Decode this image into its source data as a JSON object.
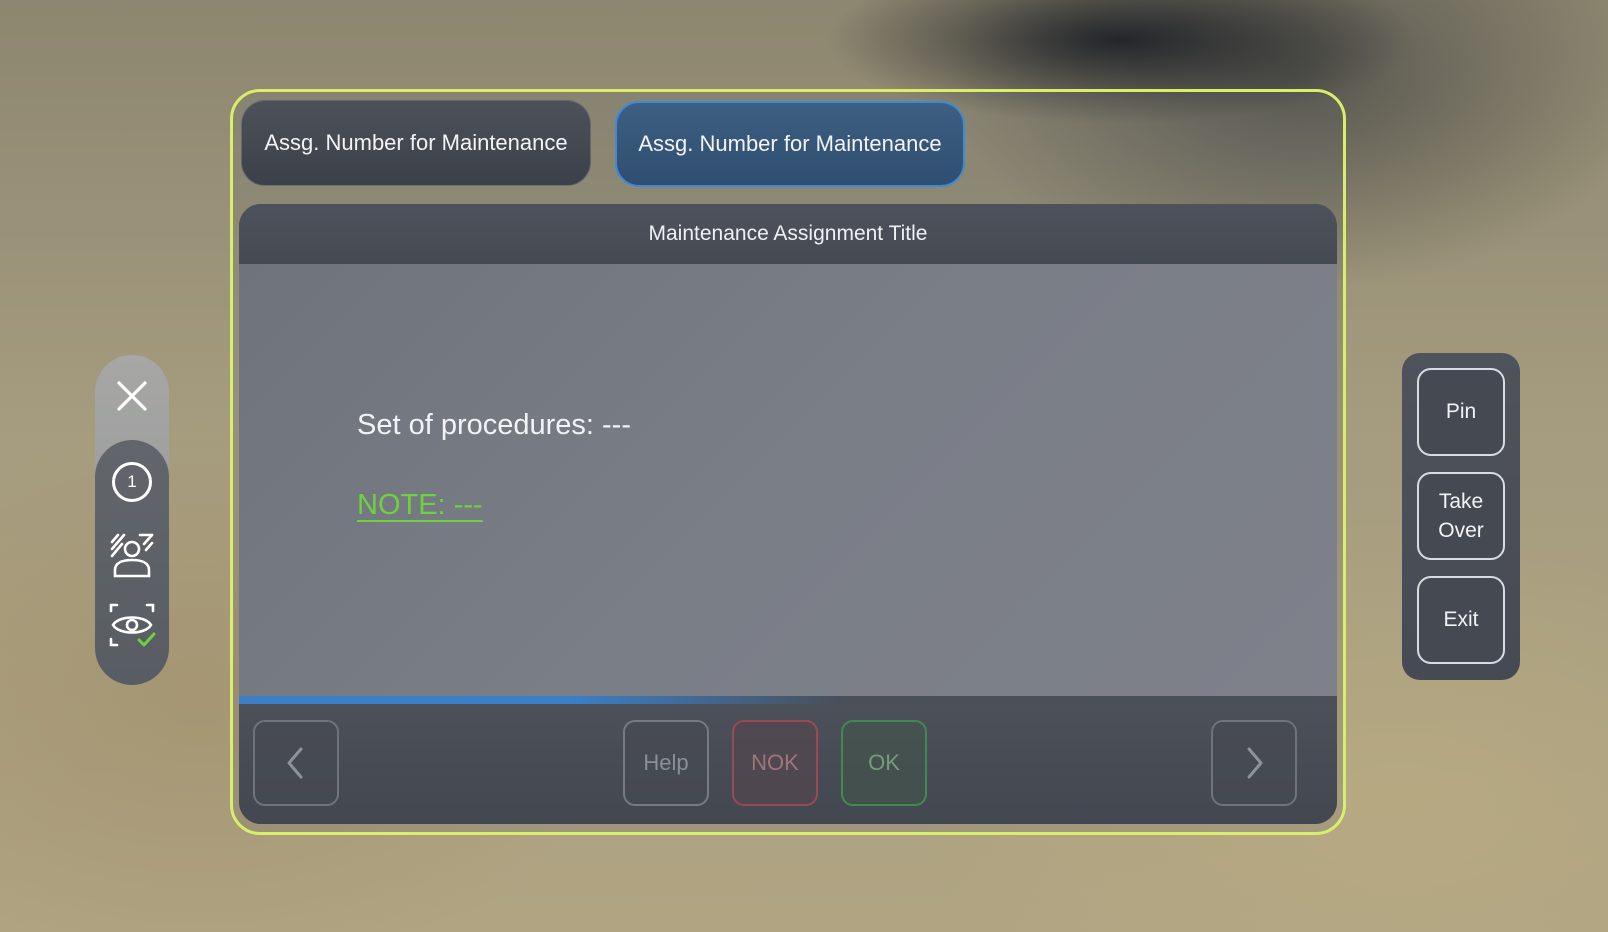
{
  "tabs": [
    {
      "label": "Assg. Number for Maintenance"
    },
    {
      "label": "Assg. Number for Maintenance"
    }
  ],
  "content": {
    "title": "Maintenance Assignment Title",
    "procedures": "Set of procedures: ---",
    "note": "NOTE: ---",
    "progress_fraction": 0.55
  },
  "footer": {
    "help_label": "Help",
    "nok_label": "NOK",
    "ok_label": "OK"
  },
  "left_toolbar": {
    "step_number": "1"
  },
  "right_toolbar": {
    "pin_label": "Pin",
    "take_over_label_line1": "Take",
    "take_over_label_line2": "Over",
    "exit_label": "Exit"
  },
  "colors": {
    "panel_border": "#d9ef6b",
    "active_tab": "#2f4e70",
    "note_green": "#6fd13d",
    "progress_blue": "#3a7fc8"
  },
  "icons": {
    "close": "close-icon",
    "step": "step-number-icon",
    "scan_person": "scan-person-icon",
    "eye_verify": "eye-verify-icon",
    "prev": "chevron-left-icon",
    "next": "chevron-right-icon"
  }
}
